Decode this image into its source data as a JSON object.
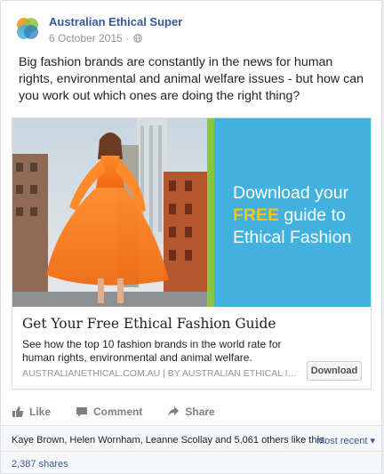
{
  "post": {
    "page_name": "Australian Ethical Super",
    "date": "6 October 2015",
    "separator": "·",
    "text": "Big fashion brands are constantly in the news for human rights, environmental and animal welfare issues - but how can you work out which ones are doing the right thing?"
  },
  "preview": {
    "promo_line1": "Download your",
    "promo_free": "FREE",
    "promo_line2": " guide to",
    "promo_line3": "Ethical Fashion",
    "title": "Get Your Free Ethical Fashion Guide",
    "description": "See how the top 10 fashion brands in the world rate for human rights, environmental and animal welfare.",
    "domain": "AUSTRALIANETHICAL.COM.AU | BY AUSTRALIAN ETHICAL INVE...",
    "button_label": "Download"
  },
  "actions": {
    "like": "Like",
    "comment": "Comment",
    "share": "Share"
  },
  "social": {
    "likes_text": "Kaye Brown, Helen Wornham, Leanne Scollay and 5,061 others like this.",
    "most_recent": "Most recent ▾",
    "shares": "2,387 shares"
  },
  "colors": {
    "link_blue": "#365899",
    "promo_blue": "#43b1e0",
    "promo_yellow": "#ffc20e",
    "brand_green": "#8cc63f",
    "muted_gray": "#90949c"
  }
}
